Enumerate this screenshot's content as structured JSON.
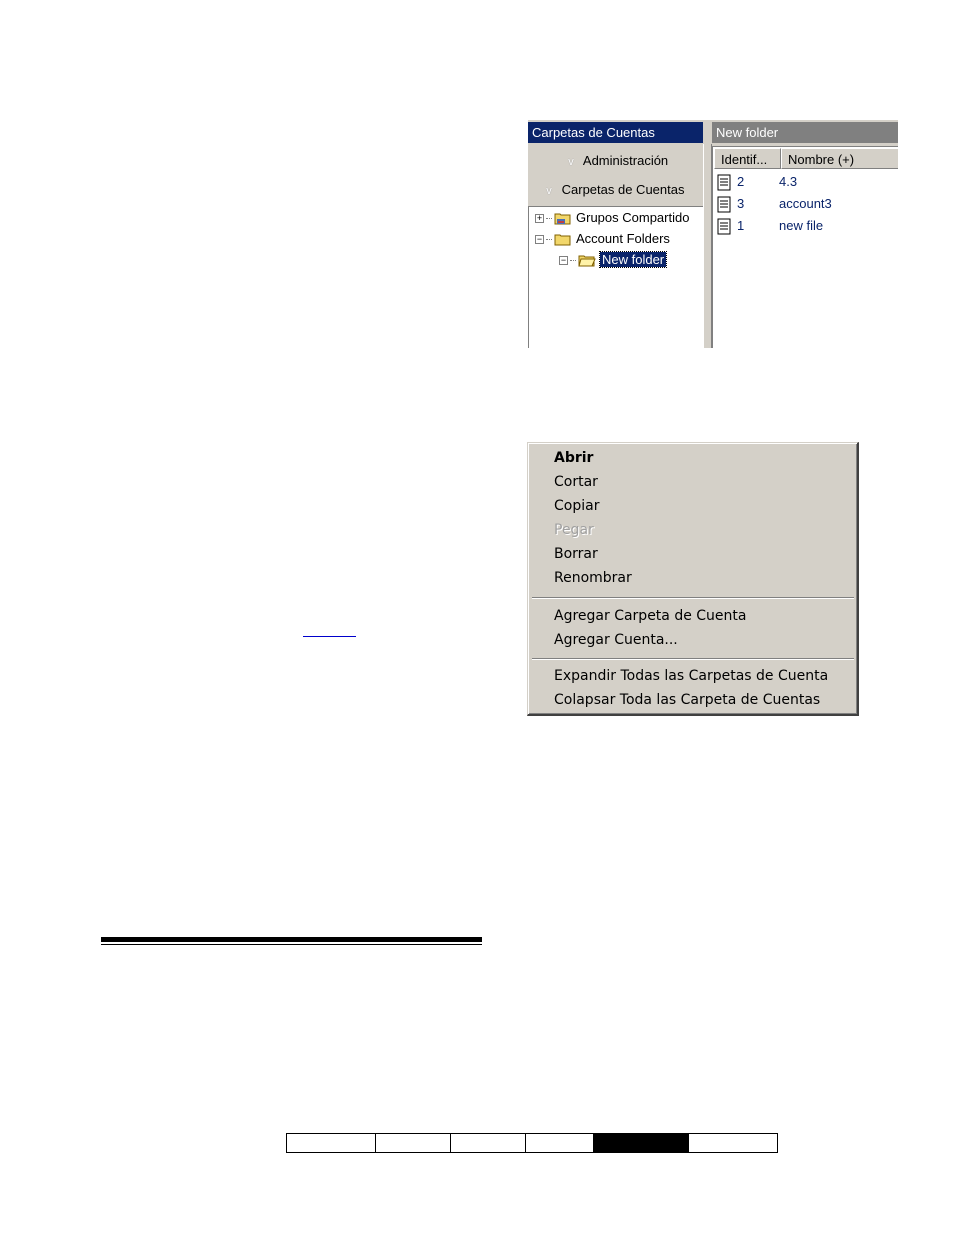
{
  "explorer": {
    "left_title": "Carpetas de Cuentas",
    "right_title": "New folder",
    "nav_sections": [
      {
        "label": "Administración"
      },
      {
        "label": "Carpetas de Cuentas"
      }
    ],
    "tree": [
      {
        "label": "Grupos Compartido",
        "expander": "+"
      },
      {
        "label": "Account Folders",
        "expander": "−"
      },
      {
        "label": "New folder",
        "expander": "−",
        "selected": true
      }
    ],
    "list_columns": [
      "Identif...",
      "Nombre (+)"
    ],
    "list_rows": [
      {
        "id": "2",
        "name": "4.3"
      },
      {
        "id": "3",
        "name": "account3"
      },
      {
        "id": "1",
        "name": "new file"
      }
    ]
  },
  "context_menu": {
    "items": [
      {
        "label": "Abrir",
        "style": "bold"
      },
      {
        "label": "Cortar"
      },
      {
        "label": "Copiar"
      },
      {
        "label": "Pegar",
        "style": "disabled"
      },
      {
        "label": "Borrar"
      },
      {
        "label": "Renombrar"
      },
      {
        "label": "Agregar Carpeta de Cuenta"
      },
      {
        "label": "Agregar Cuenta..."
      },
      {
        "label": "Expandir Todas las Carpetas de Cuenta"
      },
      {
        "label": "Colapsar Toda las Carpeta de Cuentas"
      }
    ]
  },
  "colors": {
    "title_bar_active": "#0a246a",
    "title_bar_inactive": "#808080",
    "window_face": "#d4d0c8",
    "list_text": "#0a246a"
  },
  "nav_boxes": {
    "count": 6,
    "active_index": 4
  }
}
